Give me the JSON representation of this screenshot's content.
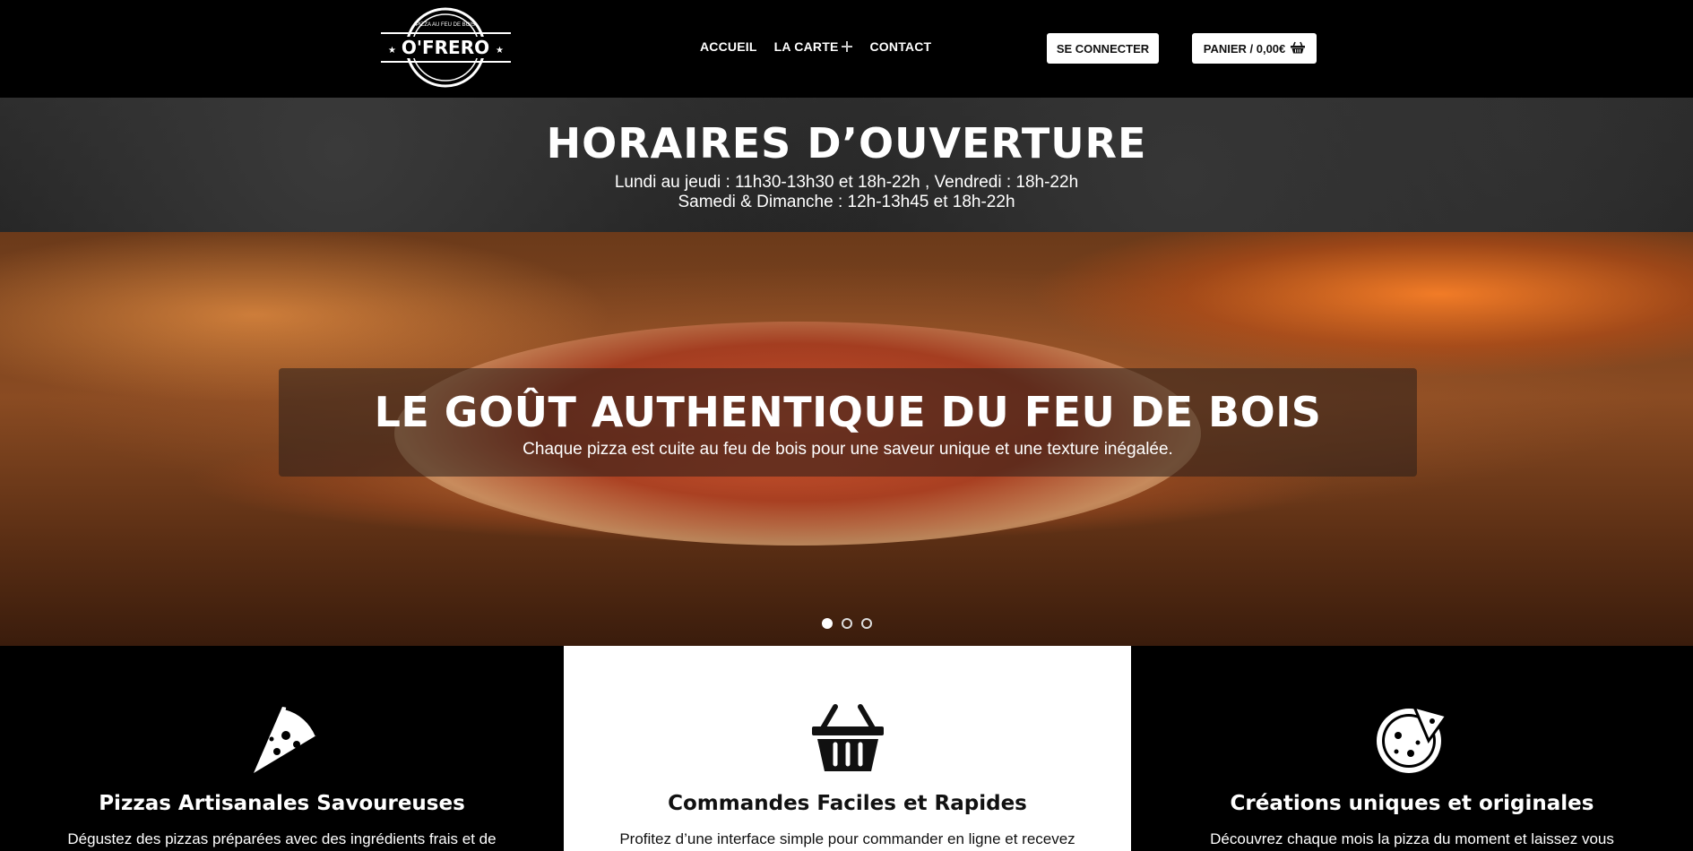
{
  "header": {
    "logo": {
      "top_text": "PIZZA AU FEU DE BOIS",
      "brand": "O'FRERO"
    },
    "nav": [
      {
        "label": "ACCUEIL"
      },
      {
        "label": "LA CARTE",
        "icon": "plus-icon"
      },
      {
        "label": "CONTACT"
      }
    ],
    "login_label": "SE CONNECTER",
    "cart_label": "PANIER / 0,00€",
    "cart_icon": "basket-icon"
  },
  "hours": {
    "title": "HORAIRES D’OUVERTURE",
    "line1": "Lundi au jeudi : 11h30-13h30 et 18h-22h , Vendredi : 18h-22h",
    "line2": "Samedi & Dimanche : 12h-13h45 et 18h-22h"
  },
  "hero": {
    "title": "LE GOÛT AUTHENTIQUE DU FEU DE BOIS",
    "subtitle": "Chaque pizza est cuite au feu de bois pour une saveur unique et une texture inégalée.",
    "slides": 3,
    "active_slide": 1
  },
  "features": [
    {
      "icon": "pizza-slice-icon",
      "title": "Pizzas Artisanales Savoureuses",
      "text": "Dégustez des pizzas préparées avec des ingrédients frais et de"
    },
    {
      "icon": "shopping-basket-icon",
      "title": "Commandes Faciles et Rapides",
      "text": "Profitez d’une interface simple pour commander en ligne et recevez"
    },
    {
      "icon": "pizza-pie-icon",
      "title": "Créations uniques et originales",
      "text": "Découvrez chaque mois la pizza du moment et laissez vous"
    }
  ],
  "colors": {
    "background": "#000000",
    "panel_light": "#ffffff",
    "text_light": "#ffffff",
    "text_dark": "#111111"
  }
}
